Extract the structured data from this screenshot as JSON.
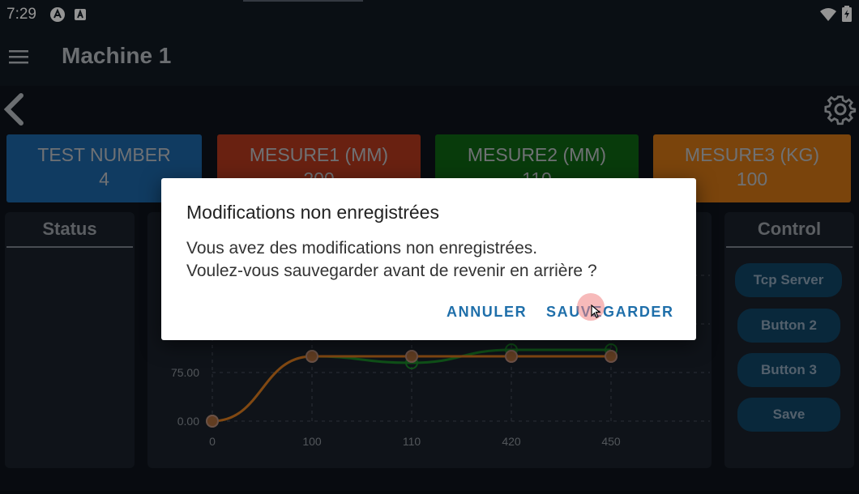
{
  "statusbar": {
    "time": "7:29",
    "icons": [
      "android-icon",
      "a-icon",
      "wifi-icon",
      "battery-icon"
    ]
  },
  "appbar": {
    "title": "Machine 1"
  },
  "cards": [
    {
      "label": "TEST NUMBER",
      "value": "4",
      "color": "#1c66a8"
    },
    {
      "label": "MESURE1 (MM)",
      "value": "200",
      "color": "#b53a1e"
    },
    {
      "label": "MESURE2 (MM)",
      "value": "110",
      "color": "#0f6614"
    },
    {
      "label": "MESURE3 (KG)",
      "value": "100",
      "color": "#d27616"
    }
  ],
  "status_panel": {
    "title": "Status"
  },
  "control_panel": {
    "title": "Control",
    "buttons": [
      "Tcp Server",
      "Button 2",
      "Button 3",
      "Save"
    ]
  },
  "chart_data": {
    "type": "line",
    "x": [
      "0",
      "100",
      "110",
      "420",
      "450"
    ],
    "y_ticks_visible": [
      "0.00",
      "75.00"
    ],
    "series": [
      {
        "color": "#d45a2a",
        "values": [
          0,
          100,
          100,
          100,
          100
        ]
      },
      {
        "color": "#1a8a2a",
        "values": [
          0,
          100,
          90,
          110,
          110
        ]
      },
      {
        "color": "#e07a20",
        "values": [
          0,
          100,
          100,
          100,
          100
        ]
      }
    ]
  },
  "dialog": {
    "title": "Modifications non enregistrées",
    "message_line1": "Vous avez des modifications non enregistrées.",
    "message_line2": "Voulez-vous sauvegarder avant de revenir en arrière ?",
    "cancel_label": "ANNULER",
    "save_label": "SAUVEGARDER"
  },
  "colors": {
    "accent": "#1f6faa",
    "background": "#0e141c",
    "panel": "#1a222c"
  }
}
